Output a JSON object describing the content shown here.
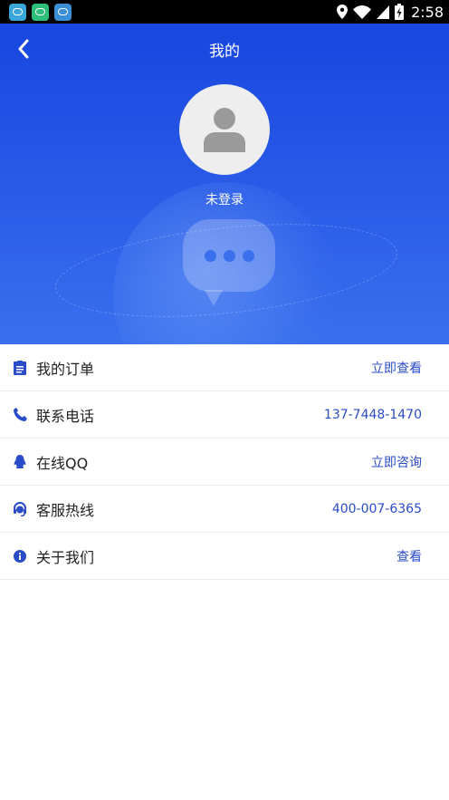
{
  "status_bar": {
    "time": "2:58",
    "battery_icon": "battery-charging-icon",
    "signal_icon": "cell-signal-icon",
    "wifi_icon": "wifi-icon",
    "location_icon": "location-pin-icon"
  },
  "header": {
    "title": "我的",
    "login_status": "未登录",
    "back_icon": "chevron-left-icon",
    "avatar_icon": "user-silhouette-icon",
    "background_color": "#1846e0"
  },
  "menu": {
    "items": [
      {
        "label": "我的订单",
        "value": "立即查看",
        "icon": "clipboard-icon"
      },
      {
        "label": "联系电话",
        "value": "137-7448-1470",
        "icon": "phone-icon"
      },
      {
        "label": "在线QQ",
        "value": "立即咨询",
        "icon": "qq-penguin-icon"
      },
      {
        "label": "客服热线",
        "value": "400-007-6365",
        "icon": "headset-icon"
      },
      {
        "label": "关于我们",
        "value": "查看",
        "icon": "info-icon"
      }
    ],
    "accent_color": "#2b4cc8"
  }
}
